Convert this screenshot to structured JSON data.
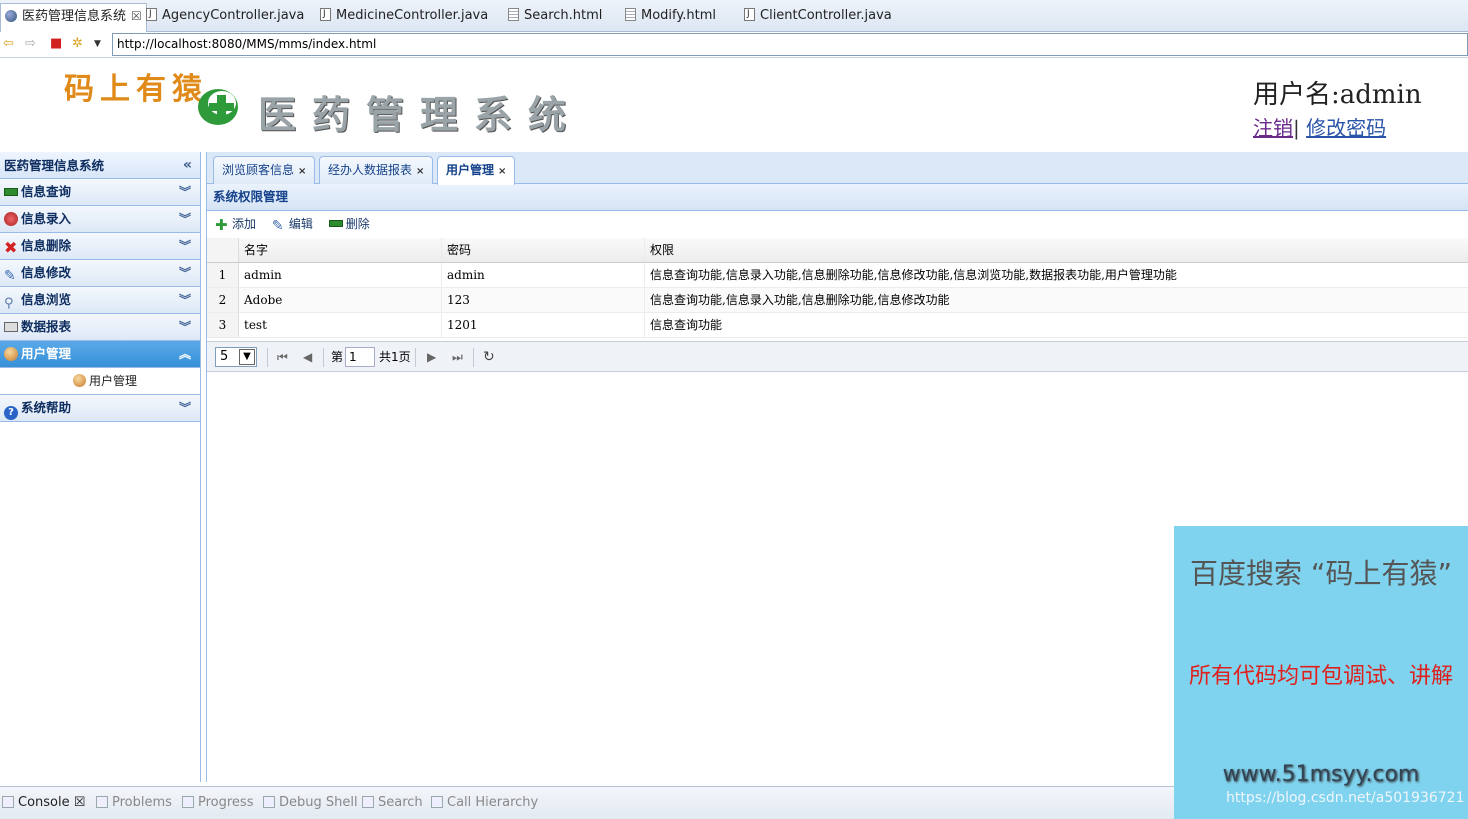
{
  "editor_tabs": [
    {
      "label": "医药管理信息系统",
      "icon": "globe-icon",
      "active": true
    },
    {
      "label": "AgencyController.java",
      "icon": "java-file-icon"
    },
    {
      "label": "MedicineController.java",
      "icon": "java-file-icon"
    },
    {
      "label": "Search.html",
      "icon": "html-file-icon"
    },
    {
      "label": "Modify.html",
      "icon": "html-file-icon"
    },
    {
      "label": "ClientController.java",
      "icon": "java-file-icon"
    }
  ],
  "address": {
    "url": "http://localhost:8080/MMS/mms/index.html"
  },
  "header": {
    "brand": "码上有猿",
    "system_title": "医药管理系统",
    "username": "用户名:admin",
    "logout": "注销",
    "separator": "|",
    "change_password": "修改密码"
  },
  "sidebar": {
    "title": "医药管理信息系统",
    "items": [
      {
        "label": "信息查询",
        "icon": "search-info-icon",
        "color": "#2e8b2e"
      },
      {
        "label": "信息录入",
        "icon": "entry-icon",
        "color": "#c0392b"
      },
      {
        "label": "信息删除",
        "icon": "delete-icon",
        "color": "#d42020"
      },
      {
        "label": "信息修改",
        "icon": "edit-icon",
        "color": "#3a6ab0"
      },
      {
        "label": "信息浏览",
        "icon": "magnifier-icon",
        "color": "#5a7aa8"
      },
      {
        "label": "数据报表",
        "icon": "printer-icon",
        "color": "#666666"
      },
      {
        "label": "用户管理",
        "icon": "user-icon",
        "color": "#d88a2a"
      },
      {
        "label": "系统帮助",
        "icon": "help-icon",
        "color": "#2a64c8"
      }
    ],
    "submenu_label": "用户管理"
  },
  "main": {
    "tabs": [
      {
        "label": "浏览顾客信息"
      },
      {
        "label": "经办人数据报表"
      },
      {
        "label": "用户管理",
        "active": true
      }
    ],
    "panel_title": "系统权限管理",
    "toolbar": {
      "add": "添加",
      "edit": "编辑",
      "delete": "删除"
    },
    "columns": [
      "名字",
      "密码",
      "权限"
    ],
    "rows": [
      {
        "num": "1",
        "name": "admin",
        "password": "admin",
        "permissions": "信息查询功能,信息录入功能,信息删除功能,信息修改功能,信息浏览功能,数据报表功能,用户管理功能"
      },
      {
        "num": "2",
        "name": "Adobe",
        "password": "123",
        "permissions": "信息查询功能,信息录入功能,信息删除功能,信息修改功能"
      },
      {
        "num": "3",
        "name": "test",
        "password": "1201",
        "permissions": "信息查询功能"
      }
    ],
    "pager": {
      "page_size": "5",
      "page_prefix": "第",
      "page": "1",
      "total": "共1页"
    }
  },
  "console_tabs": [
    {
      "label": "Console",
      "active": true
    },
    {
      "label": "Problems"
    },
    {
      "label": "Progress"
    },
    {
      "label": "Debug Shell"
    },
    {
      "label": "Search"
    },
    {
      "label": "Call Hierarchy"
    }
  ],
  "ad": {
    "line1": "百度搜索 “码上有猿”",
    "line2": "所有代码均可包调试、讲解",
    "line3": "www.51msyy.com",
    "watermark": "https://blog.csdn.net/a501936721"
  },
  "colors": {
    "accent": "#3690d8",
    "panel_border": "#99bbe8",
    "ad_bg": "#7fd3ee"
  }
}
